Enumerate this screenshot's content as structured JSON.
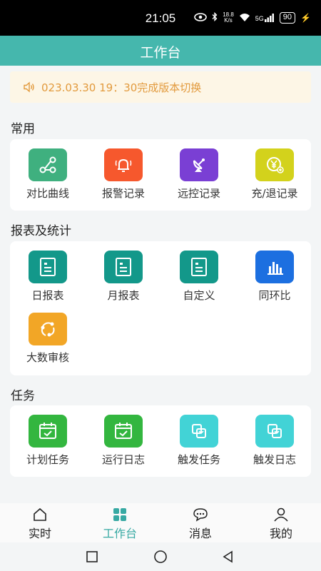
{
  "status_bar": {
    "time": "21:05",
    "net_speed_top": "18.8",
    "net_speed_bottom": "K/s",
    "signal_label": "5G",
    "battery": "90"
  },
  "header": {
    "title": "工作台"
  },
  "notice": {
    "text": "023.03.30 19：30完成版本切换"
  },
  "sections": {
    "common": {
      "title": "常用",
      "items": [
        {
          "label": "对比曲线",
          "icon": "share-nodes-icon",
          "color": "#3fb07f"
        },
        {
          "label": "报警记录",
          "icon": "alarm-bell-icon",
          "color": "#f6582d"
        },
        {
          "label": "远控记录",
          "icon": "satellite-dish-icon",
          "color": "#7a3fd4"
        },
        {
          "label": "充/退记录",
          "icon": "yen-coin-icon",
          "color": "#d3d21c"
        }
      ]
    },
    "reports": {
      "title": "报表及统计",
      "items": [
        {
          "label": "日报表",
          "icon": "report-doc-icon",
          "color": "#13988a"
        },
        {
          "label": "月报表",
          "icon": "report-doc-icon",
          "color": "#13988a"
        },
        {
          "label": "自定义",
          "icon": "report-doc-icon",
          "color": "#13988a"
        },
        {
          "label": "同环比",
          "icon": "bar-chart-icon",
          "color": "#1c6fe0"
        },
        {
          "label": "大数审核",
          "icon": "audit-cycle-icon",
          "color": "#f2a626"
        }
      ]
    },
    "tasks": {
      "title": "任务",
      "items": [
        {
          "label": "计划任务",
          "icon": "calendar-check-icon",
          "color": "#33b63f"
        },
        {
          "label": "运行日志",
          "icon": "calendar-check-icon",
          "color": "#33b63f"
        },
        {
          "label": "触发任务",
          "icon": "trigger-icon",
          "color": "#42d3d6"
        },
        {
          "label": "触发日志",
          "icon": "trigger-icon",
          "color": "#42d3d6"
        }
      ]
    }
  },
  "bottom_nav": [
    {
      "label": "实时",
      "icon": "home-icon",
      "active": false
    },
    {
      "label": "工作台",
      "icon": "workbench-grid-icon",
      "active": true
    },
    {
      "label": "消息",
      "icon": "message-bubble-icon",
      "active": false
    },
    {
      "label": "我的",
      "icon": "user-icon",
      "active": false
    }
  ],
  "colors": {
    "header": "#45b7ad",
    "active_nav": "#37a9a3",
    "notice_text": "#e29a3d"
  }
}
